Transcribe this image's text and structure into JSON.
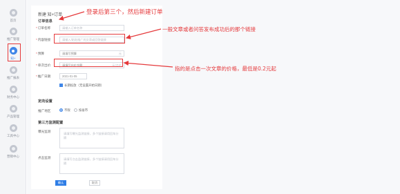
{
  "sidebar": {
    "items": [
      {
        "label": "首页",
        "icon": "home-icon"
      },
      {
        "label": "推广管理",
        "icon": "promotion-icon"
      },
      {
        "label": "知+",
        "icon": "zhiplus-icon",
        "active": true
      },
      {
        "label": "推广报表",
        "icon": "report-icon"
      },
      {
        "label": "财务中心",
        "icon": "finance-icon"
      },
      {
        "label": "产品管理",
        "icon": "product-icon"
      },
      {
        "label": "工具中心",
        "icon": "tools-icon"
      },
      {
        "label": "营销中心",
        "icon": "marketing-icon"
      }
    ]
  },
  "form": {
    "page_title": "新建 知+订单",
    "order_section": "订单信息",
    "order_name_label": "订单名称",
    "order_name_placeholder": "请输入订单名称",
    "content_link_label": "内容链接",
    "content_link_placeholder": "请输入/粘贴推广的文章或回答链接",
    "budget_label": "预算",
    "budget_value": "请填写预算",
    "budget_unit": "元",
    "bid_label": "单次出价",
    "bid_value": "请填写出价金额",
    "bid_unit": "元/点击",
    "date_label": "推广日期",
    "date_value": "2021-01-05",
    "date_checkbox_label": "长期投放（无设置开始日期）",
    "target_section": "定向设置",
    "region_label": "推广地区",
    "region_options": [
      "不限",
      "按省市"
    ],
    "third_section": "第三方监测配置",
    "monitor1_label": "曝光监测",
    "monitor1_placeholder": "请填写曝光监测链接，多个链接请用回车分隔",
    "monitor2_label": "点击监测",
    "monitor2_placeholder": "请填写点击监测链接，多个链接请用回车分隔",
    "submit_label": "确认",
    "cancel_label": "取消"
  },
  "annotations": {
    "note1": "登录后第三个，然后新建订单",
    "note2": "一般文章或者问答发布成功后的那个链接",
    "note3": "指的是点击一次文章的价格，最低是0.2元起"
  },
  "colors": {
    "annotation": "#e5393b",
    "accent": "#3f86e8"
  }
}
